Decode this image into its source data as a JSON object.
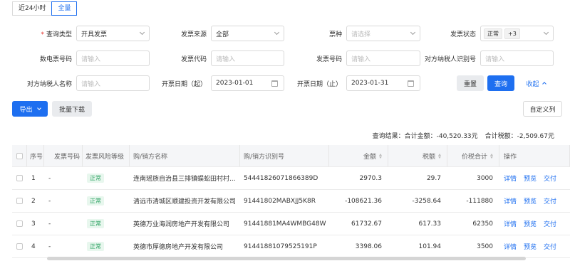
{
  "time_tabs": [
    "近24小时",
    "全量"
  ],
  "filters": {
    "query_type": {
      "label": "查询类型",
      "value": "开具发票"
    },
    "invoice_source": {
      "label": "发票来源",
      "value": "全部"
    },
    "ticket_type": {
      "label": "票种",
      "placeholder": "请选择"
    },
    "invoice_status": {
      "label": "发票状态",
      "tag": "正常",
      "more": "+3"
    },
    "digital_no": {
      "label": "数电票号码",
      "placeholder": "请输入"
    },
    "invoice_code": {
      "label": "发票代码",
      "placeholder": "请输入"
    },
    "invoice_number": {
      "label": "发票号码",
      "placeholder": "请输入"
    },
    "counterparty_taxid": {
      "label": "对方纳税人识别号",
      "placeholder": "请输入"
    },
    "counterparty_name": {
      "label": "对方纳税人名称",
      "placeholder": "请输入"
    },
    "date_start": {
      "label": "开票日期（起）",
      "value": "2023-01-01"
    },
    "date_end": {
      "label": "开票日期（止）",
      "value": "2023-01-31"
    }
  },
  "buttons": {
    "reset": "重置",
    "search": "查询",
    "collapse": "收起",
    "export": "导出",
    "batch_download": "批量下载",
    "customize_columns": "自定义列"
  },
  "summary": {
    "result_label": "查询结果：",
    "total_amount": "合计金额：-40,520.33元",
    "total_tax": "合计税额：-2,509.67元"
  },
  "table": {
    "headers": {
      "seq": "序号",
      "invoice_no": "发票号码",
      "risk_level": "发票风险等级",
      "name": "购/销方名称",
      "taxid": "购/销方识别号",
      "amount": "金额",
      "tax": "税额",
      "total": "价税合计",
      "ops": "操作"
    },
    "rows": [
      {
        "seq": "1",
        "invoice_no": "-",
        "risk": "正常",
        "name": "连南瑶族自治县三排镇蜈蚣田村村...",
        "taxid": "54441826071866389D",
        "amount": "2970.3",
        "tax": "29.7",
        "total": "3000"
      },
      {
        "seq": "2",
        "invoice_no": "-",
        "risk": "正常",
        "name": "清远市清城区顺建投资开发有限公司",
        "taxid": "91441802MABXJJ5K8R",
        "amount": "-108621.36",
        "tax": "-3258.64",
        "total": "-111880"
      },
      {
        "seq": "3",
        "invoice_no": "-",
        "risk": "正常",
        "name": "英德万业海润房地产开发有限公司",
        "taxid": "91441881MA4WMBG48W",
        "amount": "61732.67",
        "tax": "617.33",
        "total": "62350"
      },
      {
        "seq": "4",
        "invoice_no": "-",
        "risk": "正常",
        "name": "英德市厚德房地产开发有限公司",
        "taxid": "91441881079525191P",
        "amount": "3398.06",
        "tax": "101.94",
        "total": "3500"
      }
    ],
    "row_actions": [
      "详情",
      "预览",
      "交付"
    ]
  }
}
